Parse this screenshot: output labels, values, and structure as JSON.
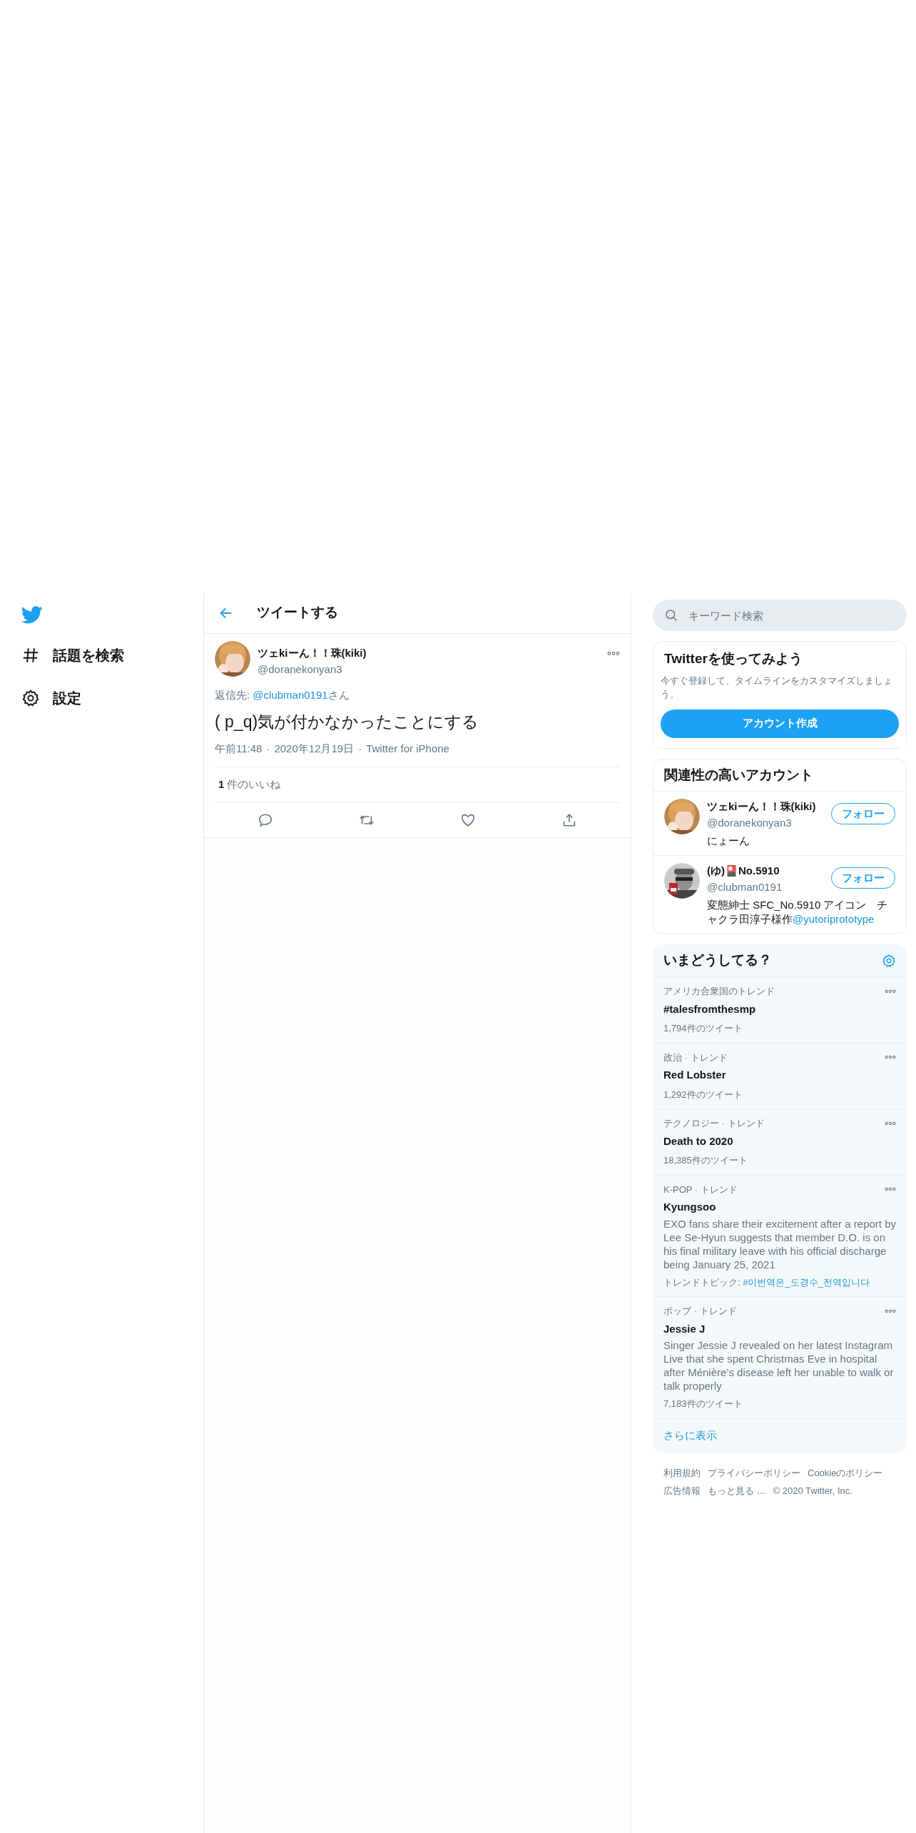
{
  "nav": [
    {
      "kind": "hash",
      "label": "話題を検索"
    },
    {
      "kind": "gear",
      "label": "設定"
    }
  ],
  "header": {
    "title": "ツイートする"
  },
  "tweet": {
    "name": "ツェkiーん！！珠(kiki)",
    "handle": "@doranekonyan3",
    "reply_prefix": "返信先: ",
    "reply_to": "@clubman0191",
    "reply_suffix": "さん",
    "text": "( p_q)気が付かなかったことにする",
    "time": "午前11:48",
    "date": "2020年12月19日",
    "source": "Twitter for iPhone",
    "separator": "·",
    "like_count": "1",
    "like_label": "件のいいね"
  },
  "search": {
    "placeholder": "キーワード検索"
  },
  "signup": {
    "title": "Twitterを使ってみよう",
    "text": "今すぐ登録して、タイムラインをカスタマイズしましょう。",
    "button": "アカウント作成"
  },
  "related": {
    "title": "関連性の高いアカウント",
    "accounts": [
      {
        "name": "ツェkiーん！！珠(kiki)",
        "handle": "@doranekonyan3",
        "bio": "にょーん",
        "button": "フォロー"
      },
      {
        "name": "(ゆ)🎴No.5910",
        "handle": "@clubman0191",
        "bio": "変態紳士 SFC_No.5910 アイコン　チャクラ田淳子様作",
        "bio_link": "@yutoriprototype",
        "button": "フォロー"
      }
    ]
  },
  "trends": {
    "title": "いまどうしてる？",
    "items": [
      {
        "context": "アメリカ合衆国のトレンド",
        "name": "#talesfromthesmp",
        "count": "1,794件のツイート"
      },
      {
        "context": "政治 · トレンド",
        "name": "Red Lobster",
        "count": "1,292件のツイート"
      },
      {
        "context": "テクノロジー · トレンド",
        "name": "Death to 2020",
        "count": "18,385件のツイート"
      },
      {
        "context": "K-POP · トレンド",
        "name": "Kyungsoo",
        "description": "EXO fans share their excitement after a report by Lee Se-Hyun suggests that member D.O. is on his final military leave with his official discharge being January 25, 2021",
        "topic_label": "トレンドトピック: ",
        "topic": "#이번역은_도경수_전역입니다"
      },
      {
        "context": "ポップ · トレンド",
        "name": "Jessie J",
        "description": "Singer Jessie J revealed on her latest Instagram Live that she spent Christmas Eve in hospital after Ménière’s disease left her unable to walk or talk properly",
        "count": "7,183件のツイート"
      }
    ],
    "more": "さらに表示"
  },
  "footer": {
    "links": [
      "利用規約",
      "プライバシーポリシー",
      "Cookieのポリシー",
      "広告情報",
      "もっと見る …"
    ],
    "copyright": "© 2020 Twitter, Inc."
  }
}
